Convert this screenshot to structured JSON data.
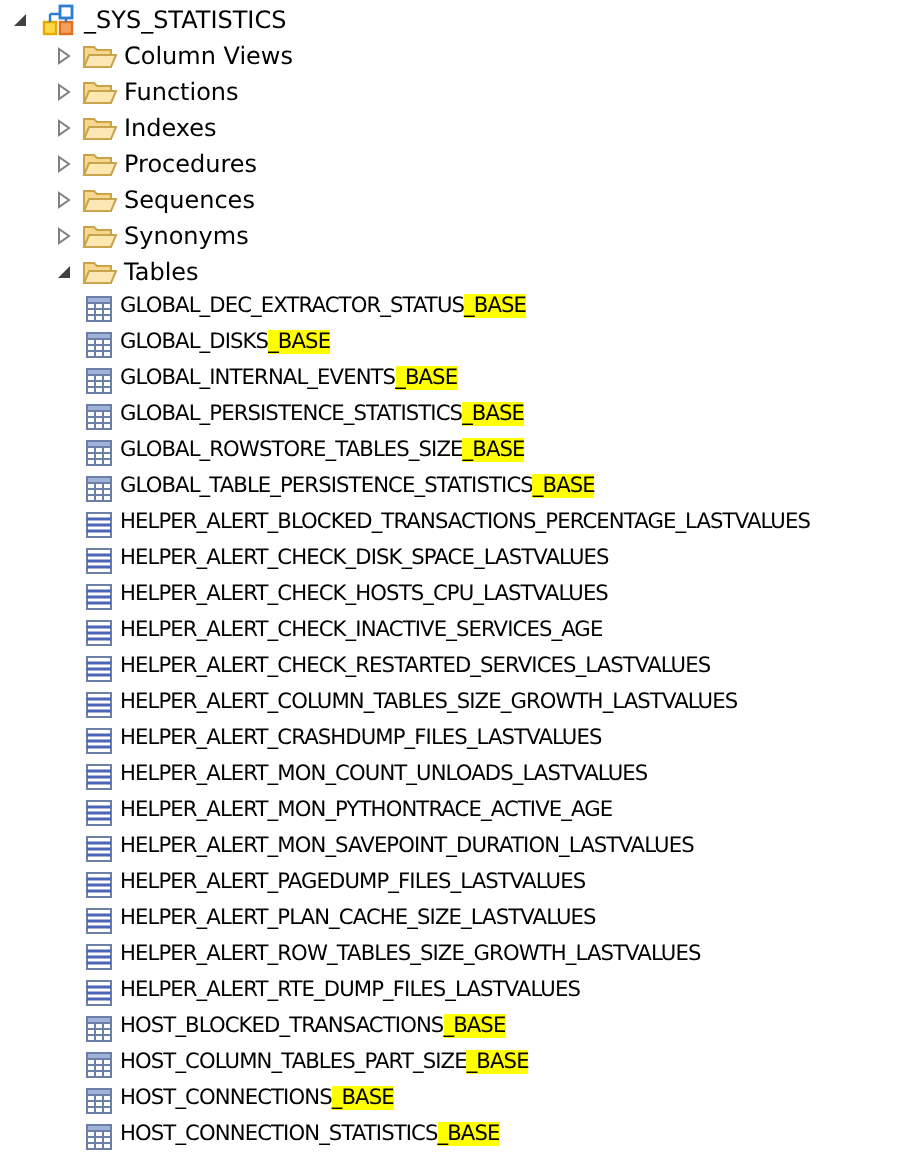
{
  "tree": {
    "label": "_SYS_STATISTICS",
    "expanded": true,
    "children": [
      {
        "label": "Column Views",
        "expanded": false
      },
      {
        "label": "Functions",
        "expanded": false
      },
      {
        "label": "Indexes",
        "expanded": false
      },
      {
        "label": "Procedures",
        "expanded": false
      },
      {
        "label": "Sequences",
        "expanded": false
      },
      {
        "label": "Synonyms",
        "expanded": false
      },
      {
        "label": "Tables",
        "expanded": true,
        "children": [
          {
            "kind": "column",
            "name": "GLOBAL_DEC_EXTRACTOR_STATUS",
            "highlight": "_BASE"
          },
          {
            "kind": "column",
            "name": "GLOBAL_DISKS",
            "highlight": "_BASE"
          },
          {
            "kind": "column",
            "name": "GLOBAL_INTERNAL_EVENTS",
            "highlight": "_BASE"
          },
          {
            "kind": "column",
            "name": "GLOBAL_PERSISTENCE_STATISTICS",
            "highlight": "_BASE"
          },
          {
            "kind": "column",
            "name": "GLOBAL_ROWSTORE_TABLES_SIZE",
            "highlight": "_BASE"
          },
          {
            "kind": "column",
            "name": "GLOBAL_TABLE_PERSISTENCE_STATISTICS",
            "highlight": "_BASE"
          },
          {
            "kind": "row",
            "name": "HELPER_ALERT_BLOCKED_TRANSACTIONS_PERCENTAGE_LASTVALUES"
          },
          {
            "kind": "row",
            "name": "HELPER_ALERT_CHECK_DISK_SPACE_LASTVALUES"
          },
          {
            "kind": "row",
            "name": "HELPER_ALERT_CHECK_HOSTS_CPU_LASTVALUES"
          },
          {
            "kind": "row",
            "name": "HELPER_ALERT_CHECK_INACTIVE_SERVICES_AGE"
          },
          {
            "kind": "row",
            "name": "HELPER_ALERT_CHECK_RESTARTED_SERVICES_LASTVALUES"
          },
          {
            "kind": "row",
            "name": "HELPER_ALERT_COLUMN_TABLES_SIZE_GROWTH_LASTVALUES"
          },
          {
            "kind": "row",
            "name": "HELPER_ALERT_CRASHDUMP_FILES_LASTVALUES"
          },
          {
            "kind": "row",
            "name": "HELPER_ALERT_MON_COUNT_UNLOADS_LASTVALUES"
          },
          {
            "kind": "row",
            "name": "HELPER_ALERT_MON_PYTHONTRACE_ACTIVE_AGE"
          },
          {
            "kind": "row",
            "name": "HELPER_ALERT_MON_SAVEPOINT_DURATION_LASTVALUES"
          },
          {
            "kind": "row",
            "name": "HELPER_ALERT_PAGEDUMP_FILES_LASTVALUES"
          },
          {
            "kind": "row",
            "name": "HELPER_ALERT_PLAN_CACHE_SIZE_LASTVALUES"
          },
          {
            "kind": "row",
            "name": "HELPER_ALERT_ROW_TABLES_SIZE_GROWTH_LASTVALUES"
          },
          {
            "kind": "row",
            "name": "HELPER_ALERT_RTE_DUMP_FILES_LASTVALUES"
          },
          {
            "kind": "column",
            "name": "HOST_BLOCKED_TRANSACTIONS",
            "highlight": "_BASE"
          },
          {
            "kind": "column",
            "name": "HOST_COLUMN_TABLES_PART_SIZE",
            "highlight": "_BASE"
          },
          {
            "kind": "column",
            "name": "HOST_CONNECTIONS",
            "highlight": "_BASE"
          },
          {
            "kind": "column",
            "name": "HOST_CONNECTION_STATISTICS",
            "highlight": "_BASE"
          }
        ]
      }
    ]
  }
}
